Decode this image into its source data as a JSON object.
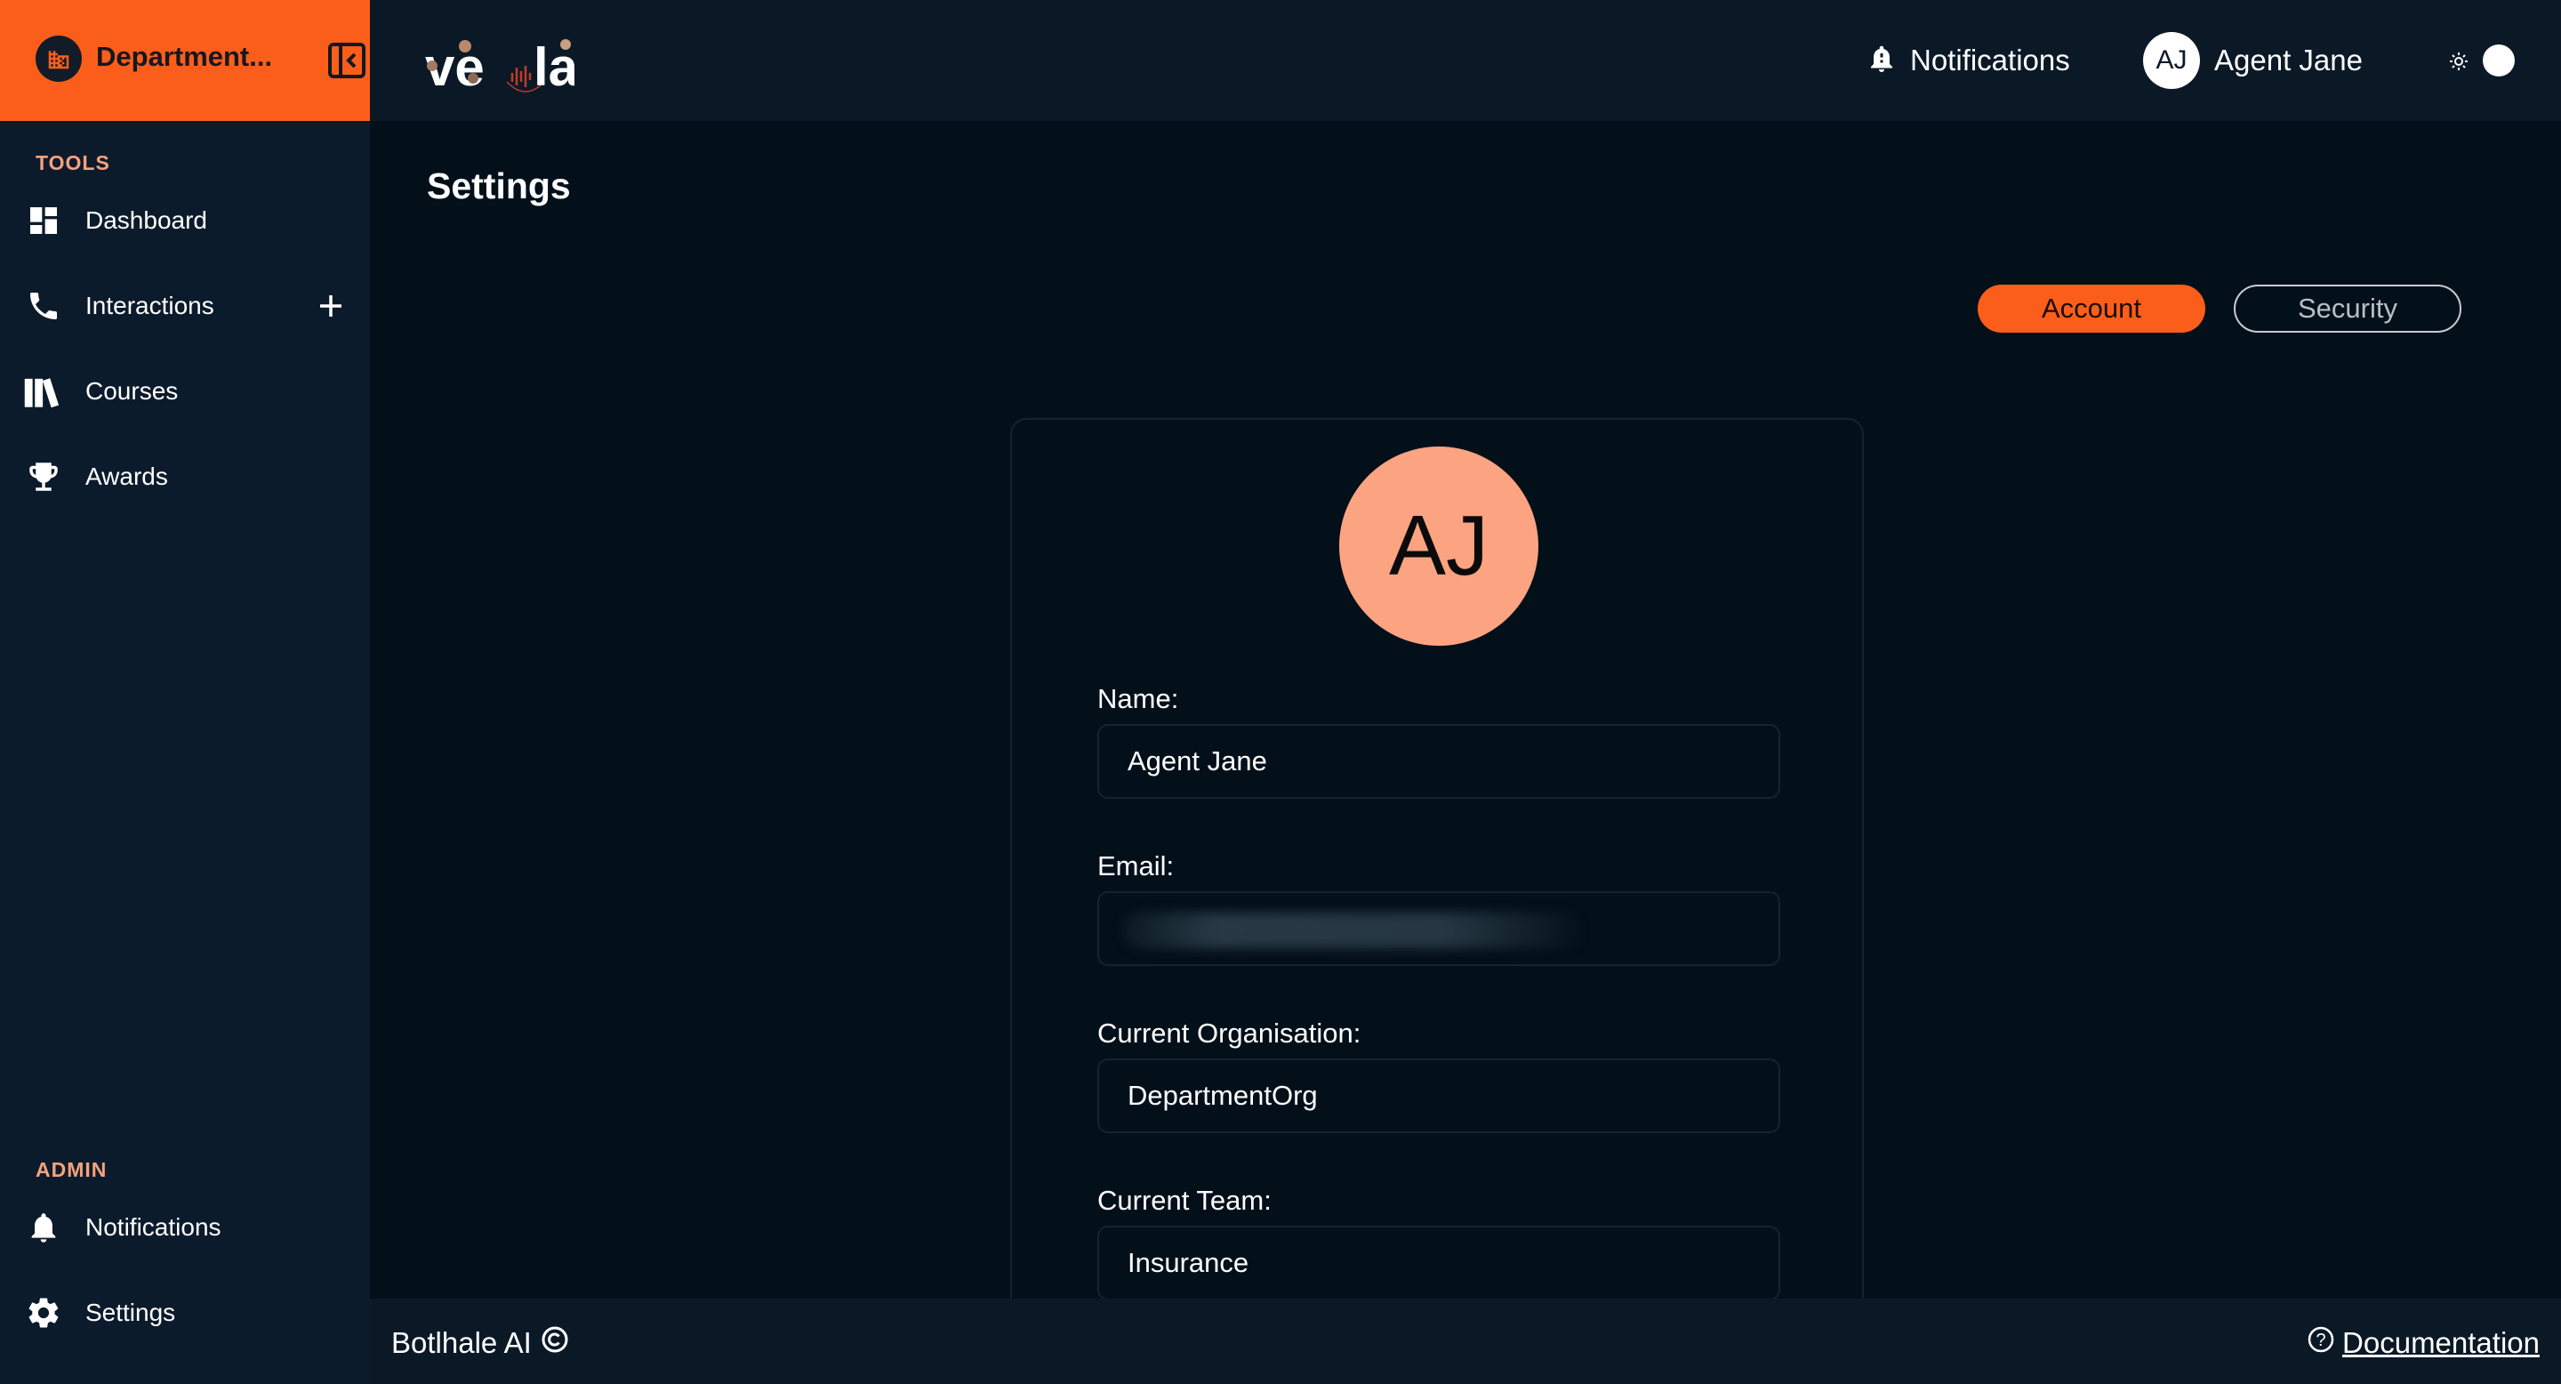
{
  "sidebar": {
    "org_name": "Department...",
    "sections": {
      "tools_label": "TOOLS",
      "admin_label": "ADMIN"
    },
    "tools": [
      {
        "label": "Dashboard",
        "icon": "dashboard-icon"
      },
      {
        "label": "Interactions",
        "icon": "phone-icon"
      },
      {
        "label": "Courses",
        "icon": "books-icon"
      },
      {
        "label": "Awards",
        "icon": "trophy-icon"
      }
    ],
    "admin": [
      {
        "label": "Notifications",
        "icon": "bell-icon"
      },
      {
        "label": "Settings",
        "icon": "gear-icon"
      }
    ]
  },
  "topbar": {
    "logo_text": "vela",
    "notifications_label": "Notifications",
    "user_initials": "AJ",
    "user_name": "Agent Jane"
  },
  "page": {
    "title": "Settings",
    "tabs": [
      {
        "label": "Account",
        "active": true
      },
      {
        "label": "Security",
        "active": false
      }
    ]
  },
  "profile": {
    "initials": "AJ",
    "fields": {
      "name": {
        "label": "Name:",
        "value": "Agent Jane"
      },
      "email": {
        "label": "Email:",
        "value": ""
      },
      "organisation": {
        "label": "Current Organisation:",
        "value": "DepartmentOrg"
      },
      "team": {
        "label": "Current Team:",
        "value": "Insurance"
      }
    }
  },
  "footer": {
    "brand": "Botlhale AI",
    "documentation_label": "Documentation"
  },
  "colors": {
    "accent": "#fb5e1a",
    "avatar_bg": "#fca382",
    "sidebar_bg": "#0c1b2c",
    "main_bg": "#03101a",
    "section_label": "#f7a27c"
  }
}
